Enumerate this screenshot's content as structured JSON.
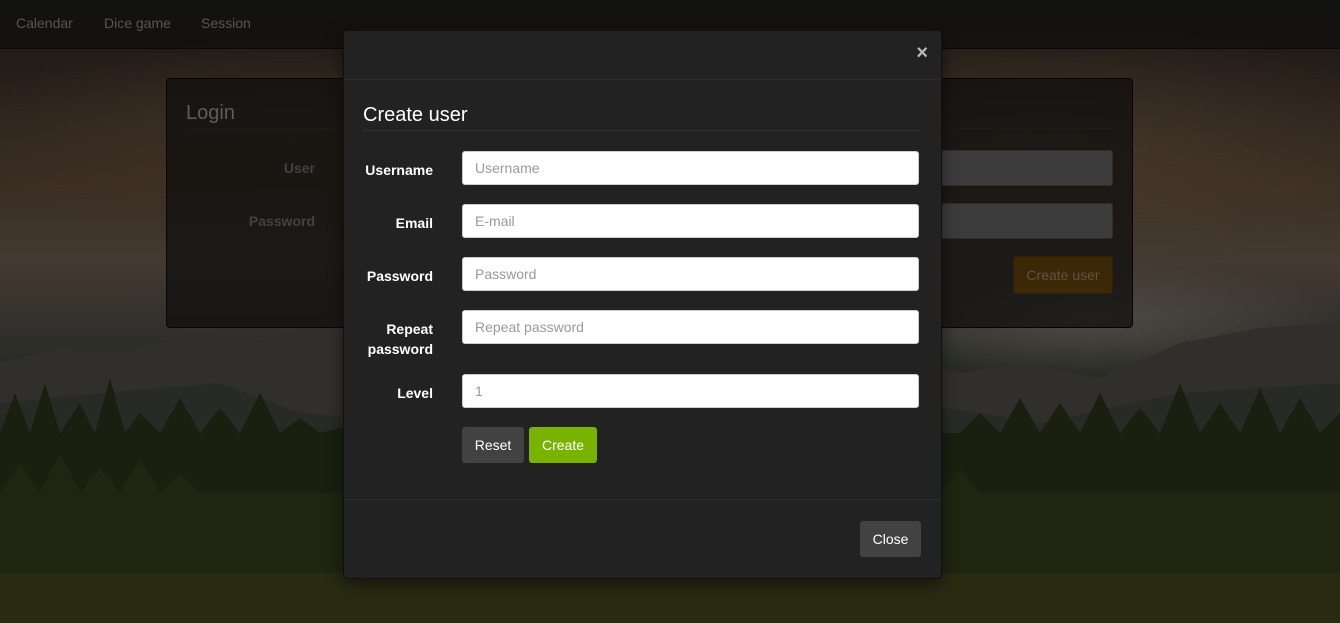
{
  "navbar": {
    "items": [
      {
        "label": "Calendar"
      },
      {
        "label": "Dice game"
      },
      {
        "label": "Session"
      }
    ]
  },
  "login": {
    "title": "Login",
    "user_label": "User",
    "password_label": "Password",
    "create_user_label": "Create user"
  },
  "modal": {
    "title": "Create user",
    "fields": {
      "username": {
        "label": "Username",
        "placeholder": "Username",
        "value": ""
      },
      "email": {
        "label": "Email",
        "placeholder": "E-mail",
        "value": ""
      },
      "password": {
        "label": "Password",
        "placeholder": "Password",
        "value": ""
      },
      "repeat_password": {
        "label": "Repeat password",
        "placeholder": "Repeat password",
        "value": ""
      },
      "level": {
        "label": "Level",
        "placeholder": "1",
        "value": ""
      }
    },
    "reset_label": "Reset",
    "create_label": "Create",
    "close_label": "Close",
    "close_icon": "×"
  },
  "colors": {
    "create_button": "#77b300",
    "secondary_button": "#424242",
    "modal_bg": "#222222",
    "login_create_button": "#6d4a0c"
  }
}
